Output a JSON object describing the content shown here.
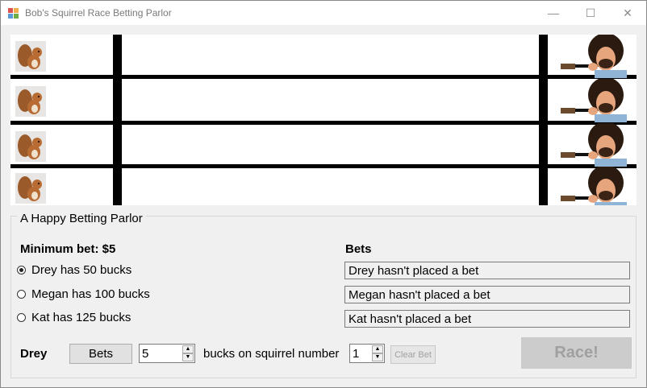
{
  "window": {
    "title": "Bob's Squirrel Race Betting Parlor",
    "controls": {
      "minimize": "—",
      "maximize": "☐",
      "close": "✕"
    }
  },
  "group": {
    "title": "A Happy Betting Parlor"
  },
  "minimum_bet_label": "Minimum bet: $5",
  "bets_label": "Bets",
  "bettors": [
    {
      "radio_label": "Drey has 50 bucks",
      "bet_text": "Drey hasn't placed a bet",
      "checked": true
    },
    {
      "radio_label": "Megan has 100 bucks",
      "bet_text": "Megan hasn't placed a bet",
      "checked": false
    },
    {
      "radio_label": "Kat has 125 bucks",
      "bet_text": "Kat hasn't placed a bet",
      "checked": false
    }
  ],
  "bet_row": {
    "name": "Drey",
    "bets_button": "Bets",
    "amount": "5",
    "bucks_label": "bucks on squirrel number",
    "squirrel_number": "1",
    "clear_button": "Clear Bet",
    "race_button": "Race!"
  },
  "icons": {
    "app": "app-icon",
    "racer": "squirrel-icon",
    "finish": "bob-ross-icon"
  }
}
